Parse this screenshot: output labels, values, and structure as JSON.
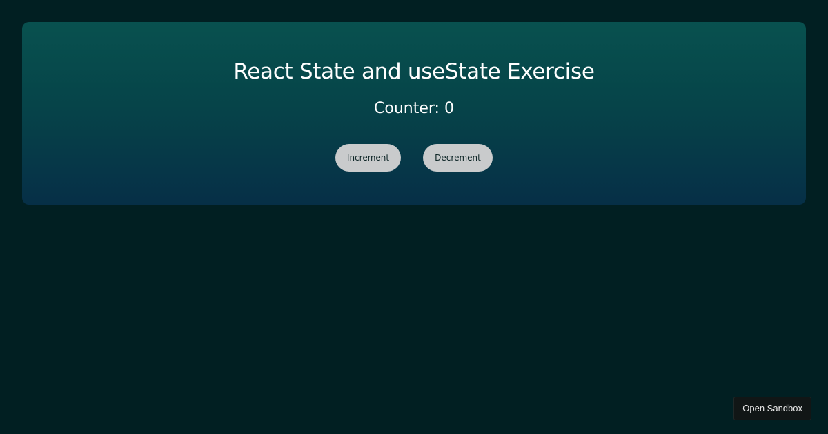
{
  "card": {
    "title": "React State and useState Exercise",
    "counter_label": "Counter:",
    "counter_value": "0",
    "buttons": {
      "increment": "Increment",
      "decrement": "Decrement"
    }
  },
  "footer": {
    "open_sandbox_label": "Open Sandbox"
  },
  "colors": {
    "background": "#011f22",
    "card_gradient_top": "#08514f",
    "card_gradient_bottom": "#062f47",
    "button_bg": "#c9cbcc"
  }
}
